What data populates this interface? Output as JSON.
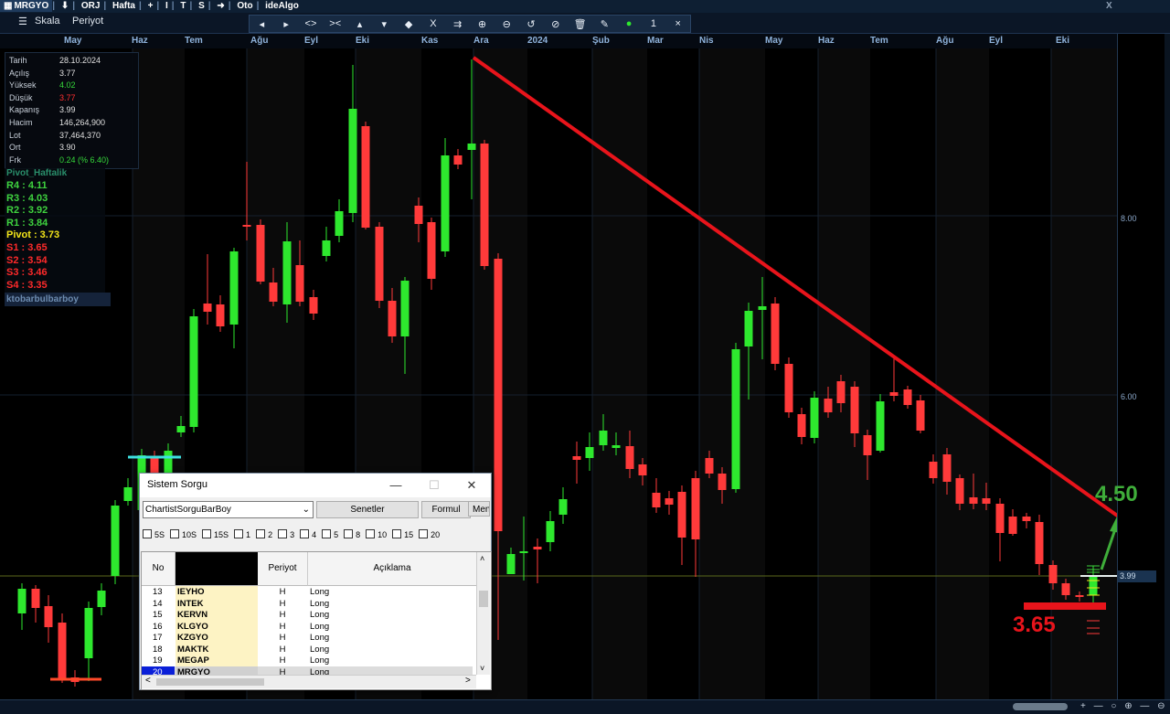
{
  "topbar": {
    "symbol": "MRGYO",
    "down_arrow": "⬇",
    "orj": "ORJ",
    "period": "Hafta",
    "plus": "+",
    "i_btn": "I",
    "t_btn": "T",
    "s_btn": "S",
    "arrow_btn": "➜",
    "oto": "Oto",
    "idealgo": "ideAlgo",
    "close": "X"
  },
  "toolbar": {
    "scale_label": "Skala",
    "period_label": "Periyot",
    "tools": [
      "◂",
      "▸",
      "<>",
      "><",
      "▴",
      "▾",
      "◆",
      "X",
      "⇉",
      "⊕",
      "⊖",
      "↺",
      "⊘",
      "🗑",
      "✎",
      "●",
      "1",
      "×"
    ]
  },
  "date_axis": {
    "labels": [
      "May",
      "Haz",
      "Tem",
      "Ağu",
      "Eyl",
      "Eki",
      "Kas",
      "Ara",
      "2024",
      "Şub",
      "Mar",
      "Nis",
      "May",
      "Haz",
      "Tem",
      "Ağu",
      "Eyl",
      "Eki"
    ]
  },
  "price_axis": {
    "labels": [
      "8.00",
      "6.00"
    ],
    "last_price": "3.99"
  },
  "info_panel": {
    "rows": [
      {
        "key": "Tarih",
        "value": "28.10.2024",
        "color": "#e0e0e0"
      },
      {
        "key": "Açılış",
        "value": "3.77",
        "color": "#e0e0e0"
      },
      {
        "key": "Yüksek",
        "value": "4.02",
        "color": "#35d83a"
      },
      {
        "key": "Düşük",
        "value": "3.77",
        "color": "#ff3030"
      },
      {
        "key": "Kapanış",
        "value": "3.99",
        "color": "#e0e0e0"
      },
      {
        "key": "Hacim",
        "value": "146,264,900",
        "color": "#e0e0e0"
      },
      {
        "key": "Lot",
        "value": "37,464,370",
        "color": "#e0e0e0"
      },
      {
        "key": "Ort",
        "value": "3.90",
        "color": "#e0e0e0"
      },
      {
        "key": "Frk",
        "value": "0.24 (% 6.40)",
        "color": "#35d83a"
      }
    ]
  },
  "pivot": {
    "title": "Pivot_Haftalik",
    "rows": [
      {
        "label": "R4 :  4.11",
        "color": "#3fd33f"
      },
      {
        "label": "R3 :  4.03",
        "color": "#3fd33f"
      },
      {
        "label": "R2 :  3.92",
        "color": "#3fd33f"
      },
      {
        "label": "R1 :  3.84",
        "color": "#3fd33f"
      },
      {
        "label": "Pivot :  3.73",
        "color": "#f2e41a"
      },
      {
        "label": "S1 :  3.65",
        "color": "#ff2a2a"
      },
      {
        "label": "S2 :  3.54",
        "color": "#ff2a2a"
      },
      {
        "label": "S3 :  3.46",
        "color": "#ff2a2a"
      },
      {
        "label": "S4 :  3.35",
        "color": "#ff2a2a"
      }
    ],
    "indicator_name": "ktobarbulbarboy"
  },
  "annotations": {
    "target": "4.50",
    "support": "3.65"
  },
  "colors": {
    "up": "#2ee82e",
    "down": "#ff3a3a",
    "trendline": "#e8141b",
    "background": "#000000"
  },
  "dialog": {
    "title": "Sistem Sorgu",
    "minimize": "—",
    "maximize": "☐",
    "close": "✕",
    "select_value": "ChartistSorguBarBoy",
    "buttons": [
      "Senetler",
      "Formul",
      "Menu"
    ],
    "checkboxes": [
      "5S",
      "10S",
      "15S",
      "1",
      "2",
      "3",
      "4",
      "5",
      "8",
      "10",
      "15",
      "20"
    ],
    "columns": [
      "No",
      "",
      "Periyot",
      "Açıklama"
    ],
    "rows": [
      {
        "no": "13",
        "symbol": "IEYHO",
        "period": "H",
        "desc": "Long"
      },
      {
        "no": "14",
        "symbol": "INTEK",
        "period": "H",
        "desc": "Long"
      },
      {
        "no": "15",
        "symbol": "KERVN",
        "period": "H",
        "desc": "Long"
      },
      {
        "no": "16",
        "symbol": "KLGYO",
        "period": "H",
        "desc": "Long"
      },
      {
        "no": "17",
        "symbol": "KZGYO",
        "period": "H",
        "desc": "Long"
      },
      {
        "no": "18",
        "symbol": "MAKTK",
        "period": "H",
        "desc": "Long"
      },
      {
        "no": "19",
        "symbol": "MEGAP",
        "period": "H",
        "desc": "Long"
      },
      {
        "no": "20",
        "symbol": "MRGYO",
        "period": "H",
        "desc": "Long"
      }
    ],
    "selected_row": "20",
    "scroll_left": "<",
    "scroll_right": ">",
    "scroll_up": "˄",
    "scroll_down": "˅"
  },
  "statusbar": {
    "icons": "+ — ○ ⊕ — ⊖"
  }
}
